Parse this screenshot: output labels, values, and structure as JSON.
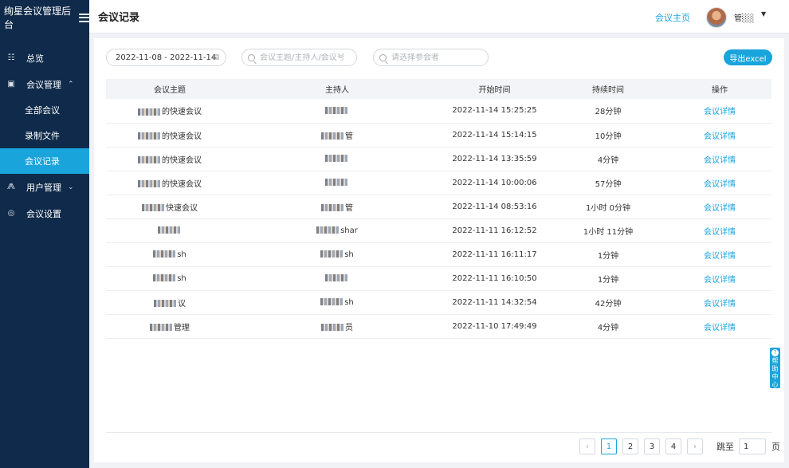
{
  "brand": {
    "title": "绚星会议管理后台"
  },
  "sidebar": {
    "items": [
      {
        "label": "总览",
        "icon": "dashboard-icon"
      },
      {
        "label": "会议管理",
        "icon": "calendar-icon",
        "expanded": true
      },
      {
        "label": "全部会议"
      },
      {
        "label": "录制文件"
      },
      {
        "label": "会议记录",
        "active": true
      },
      {
        "label": "用户管理",
        "icon": "org-tree-icon",
        "expanded": false
      },
      {
        "label": "会议设置",
        "icon": "settings-icon"
      }
    ]
  },
  "header": {
    "page_title": "会议记录",
    "home_link": "会议主页",
    "username": "管░░"
  },
  "filters": {
    "date_range": "2022-11-08 - 2022-11-14",
    "search_placeholder": "会议主题/主持人/会议号",
    "participant_placeholder": "请选择参会者",
    "export_label": "导出excel"
  },
  "table": {
    "columns": [
      "会议主题",
      "主持人",
      "开始时间",
      "持续时间",
      "操作"
    ],
    "rows": [
      {
        "topic": "的快速会议",
        "host": "",
        "start": "2022-11-14 15:25:25",
        "duration": "28分钟",
        "action": "会议详情"
      },
      {
        "topic": "的快速会议",
        "host": "管",
        "start": "2022-11-14 15:14:15",
        "duration": "10分钟",
        "action": "会议详情"
      },
      {
        "topic": "的快速会议",
        "host": "",
        "start": "2022-11-14 13:35:59",
        "duration": "4分钟",
        "action": "会议详情"
      },
      {
        "topic": "的快速会议",
        "host": "",
        "start": "2022-11-14 10:00:06",
        "duration": "57分钟",
        "action": "会议详情"
      },
      {
        "topic": "快速会议",
        "host": "管",
        "start": "2022-11-14 08:53:16",
        "duration": "1小时 0分钟",
        "action": "会议详情"
      },
      {
        "topic": "",
        "host": "shar",
        "start": "2022-11-11 16:12:52",
        "duration": "1小时 11分钟",
        "action": "会议详情"
      },
      {
        "topic": "sh",
        "host": "sh",
        "start": "2022-11-11 16:11:17",
        "duration": "1分钟",
        "action": "会议详情"
      },
      {
        "topic": "sh",
        "host": "",
        "start": "2022-11-11 16:10:50",
        "duration": "1分钟",
        "action": "会议详情"
      },
      {
        "topic": "议",
        "host": "sh",
        "start": "2022-11-11 14:32:54",
        "duration": "42分钟",
        "action": "会议详情"
      },
      {
        "topic": "管理",
        "host": "员",
        "start": "2022-11-10 17:49:49",
        "duration": "4分钟",
        "action": "会议详情"
      }
    ]
  },
  "pagination": {
    "prev": "‹",
    "pages": [
      "1",
      "2",
      "3",
      "4"
    ],
    "current": "1",
    "next": "›",
    "jump_label": "跳至",
    "jump_value": "1",
    "page_suffix": "页"
  },
  "help": {
    "label": "帮助中心",
    "chars": [
      "帮",
      "助",
      "中",
      "心"
    ]
  },
  "colors": {
    "sidebar_bg": "#0f2a4a",
    "accent": "#1aa4dc"
  }
}
